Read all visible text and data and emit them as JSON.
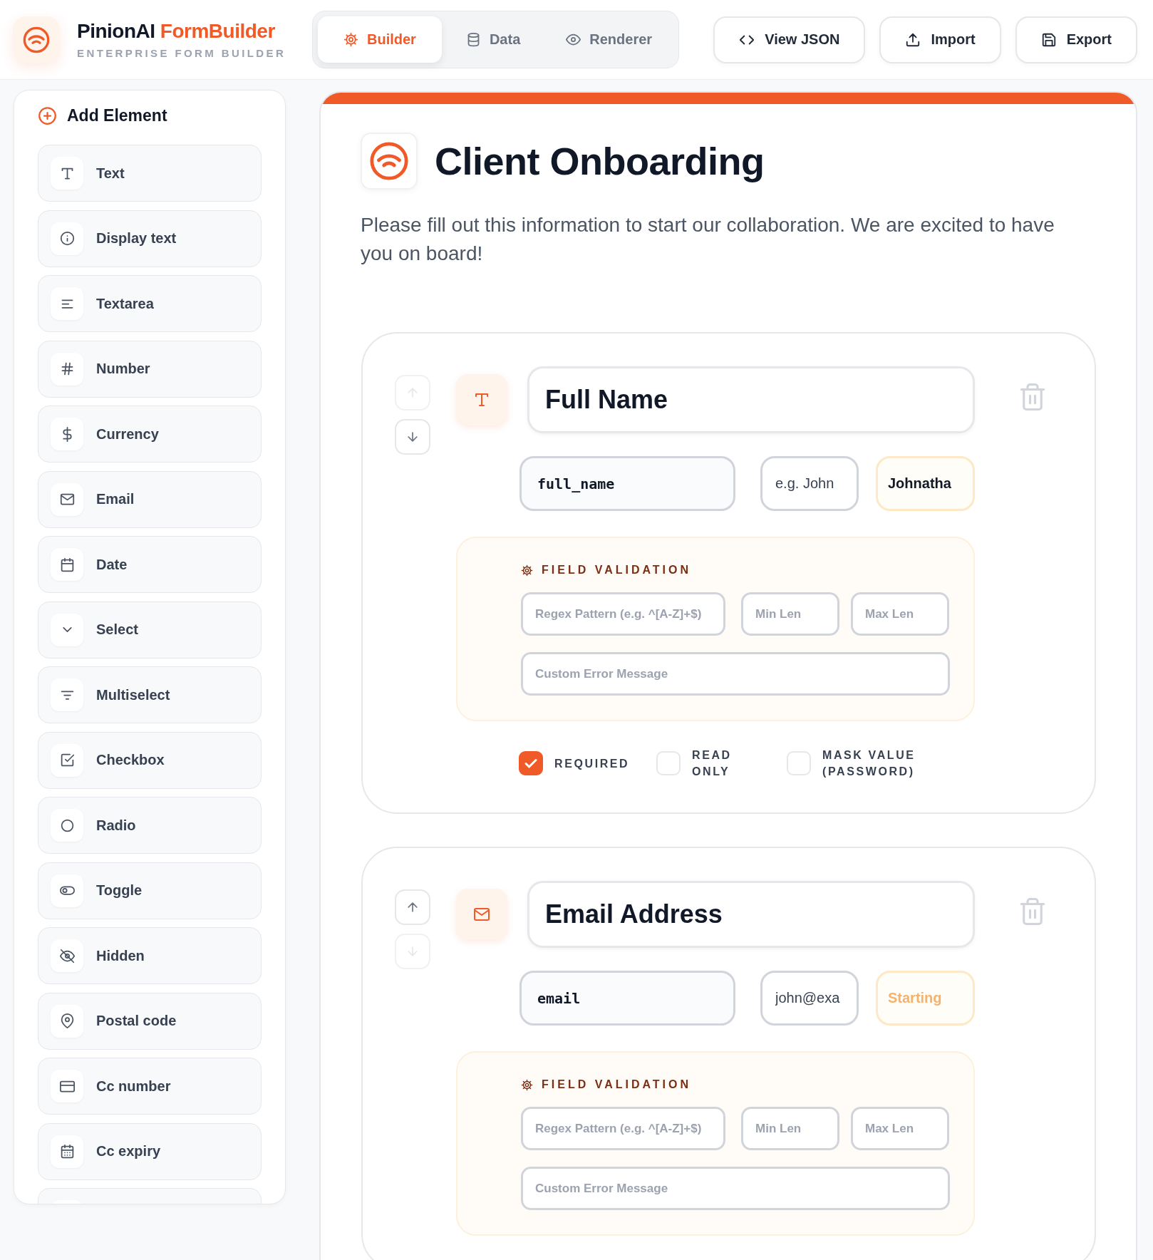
{
  "header": {
    "brand": "PinionAI",
    "brand_accent": "FormBuilder",
    "subtitle": "ENTERPRISE FORM BUILDER"
  },
  "tabs": [
    {
      "label": "Builder",
      "kind": "builder",
      "selected": true
    },
    {
      "label": "Data",
      "kind": "data",
      "selected": false
    },
    {
      "label": "Renderer",
      "kind": "renderer",
      "selected": false
    }
  ],
  "actions": [
    {
      "label": "View JSON",
      "kind": "json"
    },
    {
      "label": "Import",
      "kind": "import"
    },
    {
      "label": "Export",
      "kind": "export"
    }
  ],
  "sidebar": {
    "title": "Add Element",
    "items": [
      {
        "label": "Text",
        "kind": "text"
      },
      {
        "label": "Display text",
        "kind": "display"
      },
      {
        "label": "Textarea",
        "kind": "textarea"
      },
      {
        "label": "Number",
        "kind": "number"
      },
      {
        "label": "Currency",
        "kind": "currency"
      },
      {
        "label": "Email",
        "kind": "email"
      },
      {
        "label": "Date",
        "kind": "date"
      },
      {
        "label": "Select",
        "kind": "select"
      },
      {
        "label": "Multiselect",
        "kind": "multiselect"
      },
      {
        "label": "Checkbox",
        "kind": "checkbox"
      },
      {
        "label": "Radio",
        "kind": "radio"
      },
      {
        "label": "Toggle",
        "kind": "toggle"
      },
      {
        "label": "Hidden",
        "kind": "hidden"
      },
      {
        "label": "Postal code",
        "kind": "postal"
      },
      {
        "label": "Cc number",
        "kind": "ccnumber"
      },
      {
        "label": "Cc expiry",
        "kind": "ccexpiry"
      }
    ]
  },
  "form": {
    "title": "Client Onboarding",
    "description": "Please fill out this information to start our collaboration. We are excited to have you on board!",
    "fields": [
      {
        "kind": "text",
        "label": "Full Name",
        "key": "full_name",
        "sample_text": "e.g. John",
        "default": {
          "value": "Johnatha"
        },
        "up_disabled": true,
        "down_disabled": false,
        "validation": {
          "title": "FIELD VALIDATION",
          "regex_placeholder": "Regex Pattern (e.g. ^[A-Z]+$)",
          "min_placeholder": "Min Len",
          "max_placeholder": "Max Len",
          "error_placeholder": "Custom Error Message"
        },
        "options": [
          {
            "label": "REQUIRED",
            "checked": true
          },
          {
            "label": "READ ONLY",
            "checked": false
          },
          {
            "label": "MASK VALUE (PASSWORD)",
            "checked": false
          }
        ]
      },
      {
        "kind": "email",
        "label": "Email Address",
        "key": "email",
        "sample_text": "john@exa",
        "default": {
          "placeholder": "Starting"
        },
        "up_disabled": false,
        "down_disabled": true,
        "validation": {
          "title": "FIELD VALIDATION",
          "regex_placeholder": "Regex Pattern (e.g. ^[A-Z]+$)",
          "min_placeholder": "Min Len",
          "max_placeholder": "Max Len",
          "error_placeholder": "Custom Error Message"
        }
      }
    ]
  }
}
